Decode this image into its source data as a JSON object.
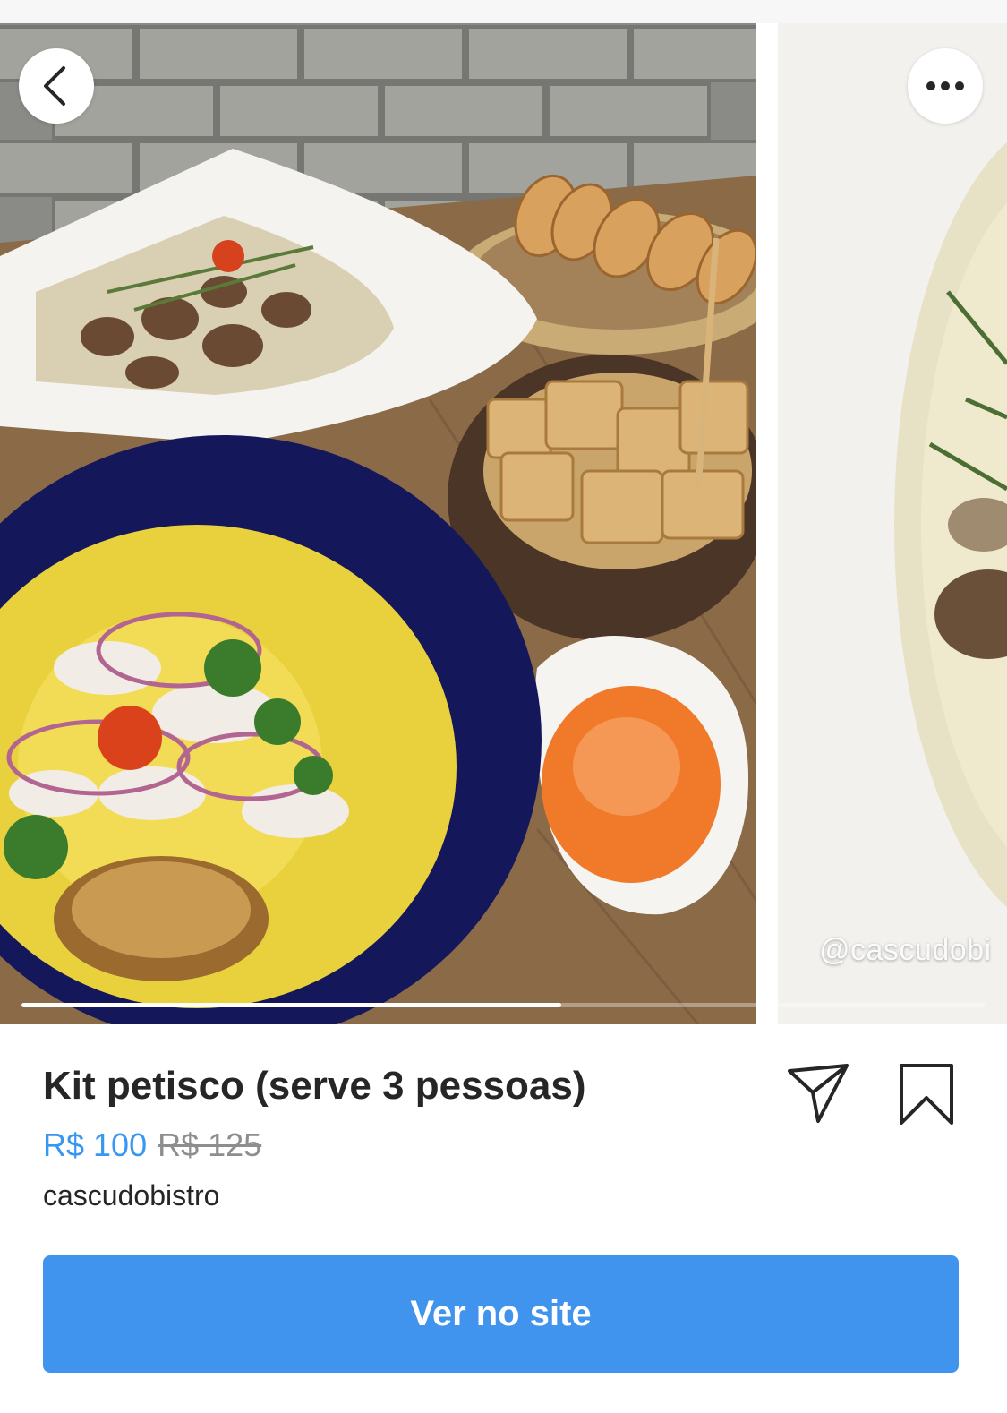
{
  "carousel": {
    "watermark": "@cascudobi",
    "progress": 0.56,
    "buttons": {
      "back_icon": "chevron-left-icon",
      "more_icon": "more-horizontal-icon"
    }
  },
  "product": {
    "title": "Kit petisco (serve 3 pessoas)",
    "price_current": "R$ 100",
    "price_original": "R$ 125",
    "seller": "cascudobistro"
  },
  "actions": {
    "share_icon": "paper-plane-icon",
    "save_icon": "bookmark-icon",
    "cta_label": "Ver no site"
  },
  "colors": {
    "accent": "#3897f0",
    "cta_background": "#4194ee",
    "muted": "#8e8e8e",
    "text": "#262626"
  }
}
